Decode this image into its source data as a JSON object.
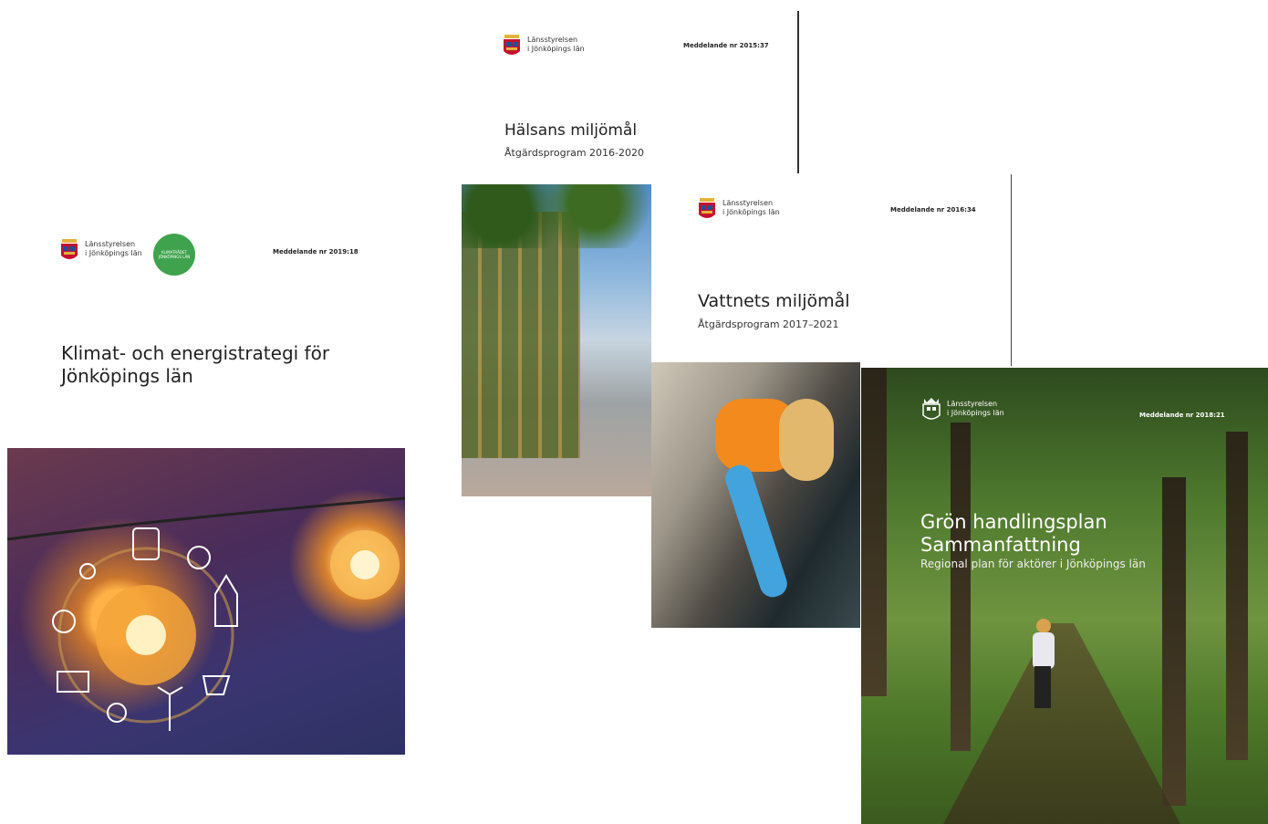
{
  "cards": [
    {
      "org_line1": "Länsstyrelsen",
      "org_line2": "i Jönköpings län",
      "badge_line1": "KLIMATRÅDET",
      "badge_line2": "JÖNKÖPINGS LÄN",
      "publication": "Meddelande nr 2019:18",
      "title_line1": "Klimat- och energistrategi för",
      "title_line2": "Jönköpings län"
    },
    {
      "org_line1": "Länsstyrelsen",
      "org_line2": "i Jönköpings län",
      "publication": "Meddelande nr 2015:37",
      "title": "Hälsans miljömål",
      "subtitle": "Åtgärdsprogram 2016-2020"
    },
    {
      "org_line1": "Länsstyrelsen",
      "org_line2": "i Jönköpings län",
      "publication": "Meddelande nr 2016:34",
      "title": "Vattnets miljömål",
      "subtitle": "Åtgärdsprogram 2017–2021"
    },
    {
      "org_line1": "Länsstyrelsen",
      "org_line2": "i Jönköpings län",
      "publication": "Meddelande nr 2018:21",
      "title_line1": "Grön handlingsplan",
      "title_line2": "Sammanfattning",
      "subtitle": "Regional plan för aktörer i Jönköpings län"
    }
  ],
  "colors": {
    "crest_red": "#c8102e",
    "crest_blue": "#1f4e9c",
    "crest_gold": "#e3b23c",
    "badge_green": "#3fa34d"
  }
}
